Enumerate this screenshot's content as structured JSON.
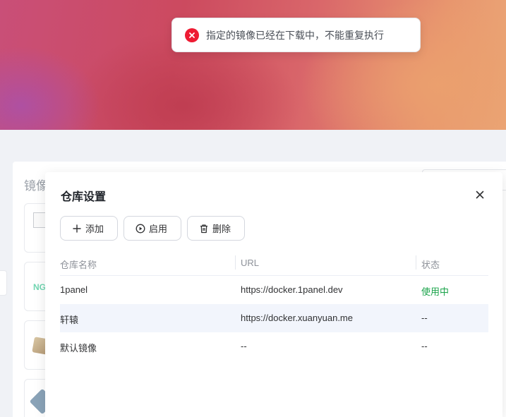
{
  "background": {
    "panel_title": "镜像",
    "left_cards": [
      {
        "icon": "broken-image-icon"
      },
      {
        "text": "NG"
      },
      {
        "icon": "package-box-icon"
      },
      {
        "icon": "blue-logo-icon"
      }
    ]
  },
  "dialog": {
    "title": "仓库设置",
    "close_icon": "close-icon",
    "toolbar": {
      "add_label": "添加",
      "enable_label": "启用",
      "delete_label": "删除"
    },
    "table": {
      "columns": [
        "仓库名称",
        "URL",
        "状态"
      ],
      "rows": [
        {
          "name": "1panel",
          "url": "https://docker.1panel.dev",
          "status": "使用中",
          "highlighted": false
        },
        {
          "name": "轩辕",
          "url": "https://docker.xuanyuan.me",
          "status": "--",
          "highlighted": true
        },
        {
          "name": "默认镜像",
          "url": "--",
          "status": "--",
          "highlighted": false
        }
      ]
    }
  },
  "toast": {
    "type": "error",
    "icon": "error-circle-icon",
    "message": "指定的镜像已经在下载中，不能重复执行"
  },
  "colors": {
    "status_active": "#1aa34a",
    "error": "#ee1b33",
    "row_highlight": "#f2f5fc"
  }
}
